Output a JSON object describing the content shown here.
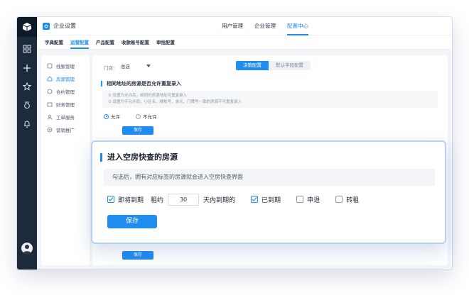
{
  "app": {
    "title": "企业设置"
  },
  "topnav": [
    {
      "label": "用户管理"
    },
    {
      "label": "企业管理"
    },
    {
      "label": "配置中心"
    }
  ],
  "subtabs": [
    {
      "label": "字典配置"
    },
    {
      "label": "运营配置"
    },
    {
      "label": "产品配置"
    },
    {
      "label": "收款账号配置"
    },
    {
      "label": "审批配置"
    }
  ],
  "sidemenu": [
    {
      "label": "线索管理",
      "icon": "clue-icon"
    },
    {
      "label": "房源管理",
      "icon": "house-icon"
    },
    {
      "label": "合约管理",
      "icon": "contract-icon"
    },
    {
      "label": "财务管理",
      "icon": "finance-icon"
    },
    {
      "label": "工单服务",
      "icon": "ticket-icon"
    },
    {
      "label": "营销推广",
      "icon": "marketing-icon"
    }
  ],
  "main": {
    "store_label": "门店:",
    "store_value": "总店",
    "seg_on": "决策配置",
    "seg_off": "默认字段配置",
    "section_title": "相同地址的房源是否允许重复录入",
    "hint_line1": "① 设置为允许后，相同的房源地址可重复录入",
    "hint_line2": "② 设置为不允许后，小区名、楼栋号、单元、门牌号一致的房源不可重复录入",
    "radio_allow": "允许",
    "radio_deny": "不允许",
    "save_label": "保存",
    "bottom_save_label": "保存"
  },
  "card": {
    "title": "进入空房快查的房源",
    "hint": "勾选后，拥有对应标签的房源就会进入空房快查界面",
    "opt_expiring": "即将到期",
    "lease_prefix": "租约",
    "days_value": "30",
    "lease_suffix": "天内到期的",
    "opt_expired": "已到期",
    "opt_checkout": "申退",
    "opt_sublet": "转租",
    "save_label": "保存"
  },
  "colors": {
    "accent": "#1f8cf0",
    "rail": "#1d2a3c"
  }
}
